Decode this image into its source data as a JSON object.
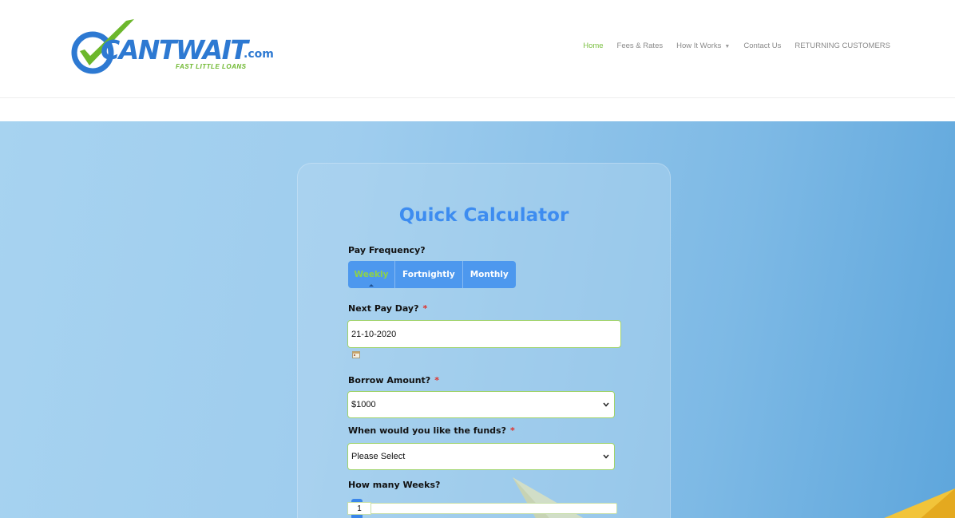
{
  "brand": {
    "name": "CANTWAIT",
    "suffix": ".com",
    "tagline": "FAST LITTLE LOANS",
    "colors": {
      "blue": "#2d79d2",
      "green": "#6cb72c"
    }
  },
  "nav": {
    "items": [
      {
        "label": "Home",
        "active": true
      },
      {
        "label": "Fees & Rates",
        "active": false
      },
      {
        "label": "How It Works",
        "active": false,
        "has_dropdown": true
      },
      {
        "label": "Contact Us",
        "active": false
      },
      {
        "label": "RETURNING CUSTOMERS",
        "active": false
      }
    ]
  },
  "calculator": {
    "title": "Quick Calculator",
    "pay_frequency": {
      "label": "Pay Frequency?",
      "options": [
        "Weekly",
        "Fortnightly",
        "Monthly"
      ],
      "selected": "Weekly"
    },
    "next_pay_day": {
      "label": "Next Pay Day?",
      "required_mark": "*",
      "value": "21-10-2020"
    },
    "borrow_amount": {
      "label": "Borrow Amount?",
      "required_mark": "*",
      "value": "$1000"
    },
    "funds_timing": {
      "label": "When would you like the funds?",
      "required_mark": "*",
      "value": "Please Select"
    },
    "weeks": {
      "label": "How many Weeks?",
      "value": "1"
    }
  },
  "icons": {
    "logo": "checkmark-circle-icon",
    "calendar": "calendar-icon",
    "dropdown": "chevron-down-icon",
    "nav_dropdown": "caret-down-icon",
    "decor": "paper-plane-icon"
  }
}
